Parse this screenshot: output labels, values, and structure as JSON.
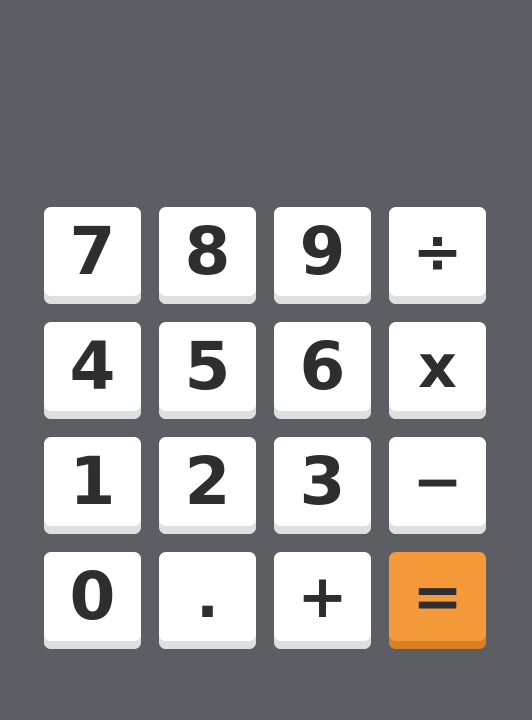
{
  "keypad": {
    "keys": [
      {
        "label": "7",
        "kind": "digit"
      },
      {
        "label": "8",
        "kind": "digit"
      },
      {
        "label": "9",
        "kind": "digit"
      },
      {
        "label": "÷",
        "kind": "operator"
      },
      {
        "label": "4",
        "kind": "digit"
      },
      {
        "label": "5",
        "kind": "digit"
      },
      {
        "label": "6",
        "kind": "digit"
      },
      {
        "label": "x",
        "kind": "operator"
      },
      {
        "label": "1",
        "kind": "digit"
      },
      {
        "label": "2",
        "kind": "digit"
      },
      {
        "label": "3",
        "kind": "digit"
      },
      {
        "label": "−",
        "kind": "operator"
      },
      {
        "label": "0",
        "kind": "digit"
      },
      {
        "label": ".",
        "kind": "decimal"
      },
      {
        "label": "+",
        "kind": "operator"
      },
      {
        "label": "=",
        "kind": "equals"
      }
    ]
  },
  "colors": {
    "background": "#5c5e64",
    "key": "#ffffff",
    "key_text": "#2e2e30",
    "equals_key": "#f59a3a"
  }
}
